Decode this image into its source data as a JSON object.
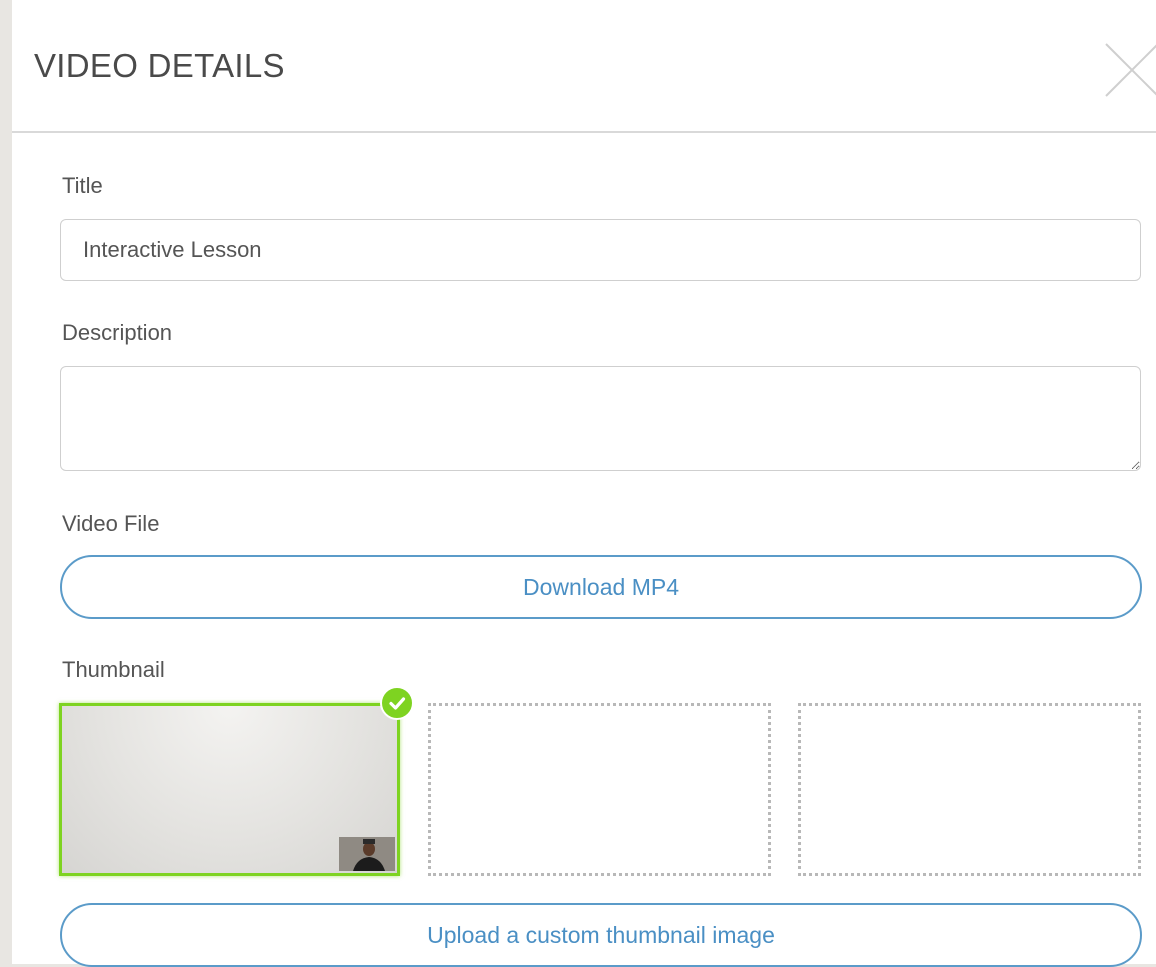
{
  "header": {
    "title": "VIDEO DETAILS",
    "close_icon": "close-x-icon"
  },
  "form": {
    "title_label": "Title",
    "title_value": "Interactive Lesson",
    "description_label": "Description",
    "description_value": "",
    "video_file_label": "Video File",
    "download_button": "Download MP4",
    "thumbnail_label": "Thumbnail",
    "upload_button": "Upload a custom thumbnail image"
  },
  "thumbnails": {
    "selected_index": 0,
    "selected_icon": "check-circle-icon",
    "count": 3
  },
  "colors": {
    "accent_blue": "#4a8fc4",
    "selected_green": "#7ed321",
    "header_text": "#4a4a4a"
  }
}
